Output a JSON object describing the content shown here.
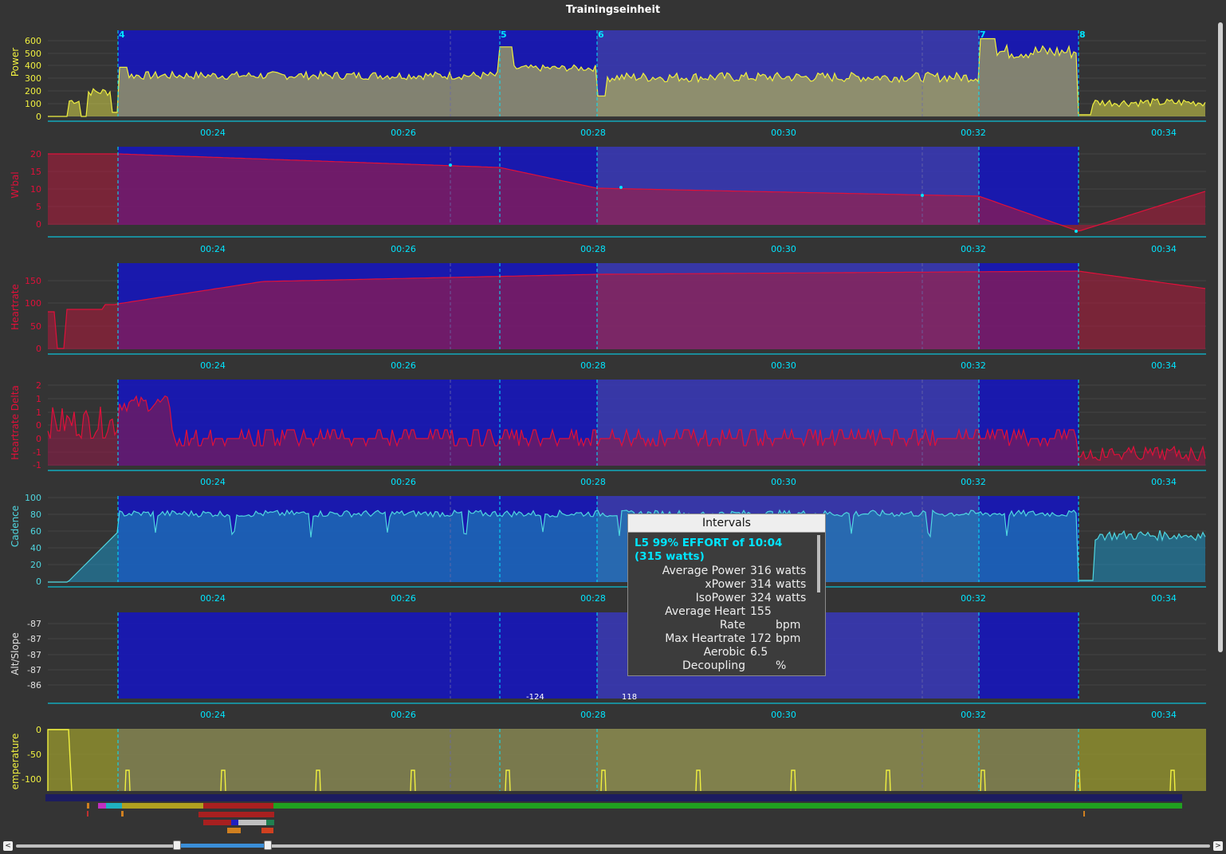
{
  "window": {
    "title": "Trainingseinheit"
  },
  "colors": {
    "background": "#343434",
    "power": "#e6e61e",
    "wbal": "#cc1133",
    "heartrate": "#cc1133",
    "cadence": "#2ab7c6",
    "axis_text": "#00e5ff",
    "interval_band": "#1414c8"
  },
  "time_ticks": [
    "00:24",
    "00:26",
    "00:28",
    "00:30",
    "00:32",
    "00:34"
  ],
  "interval_markers": [
    "4",
    "5",
    "6",
    "7",
    "8"
  ],
  "charts": [
    {
      "id": "power",
      "ylabel": "Power",
      "yticks": [
        "600",
        "500",
        "400",
        "300",
        "200",
        "100",
        "0"
      ],
      "icon": "power-line"
    },
    {
      "id": "wbal",
      "ylabel": "W'bal",
      "yticks": [
        "20",
        "15",
        "10",
        "5",
        "0"
      ],
      "icon": "wbal-line"
    },
    {
      "id": "heartrate",
      "ylabel": "Heartrate",
      "yticks": [
        "150",
        "100",
        "50",
        "0"
      ],
      "icon": "heartrate-line"
    },
    {
      "id": "hrdelta",
      "ylabel": "Heartrate Delta",
      "yticks": [
        "2",
        "1",
        "1",
        "0",
        "0",
        "-1",
        "-1"
      ],
      "icon": "hrdelta-line"
    },
    {
      "id": "cadence",
      "ylabel": "Cadence",
      "yticks": [
        "100",
        "80",
        "60",
        "40",
        "20",
        "0"
      ],
      "icon": "cadence-line"
    },
    {
      "id": "altslope",
      "ylabel": "Alt/Slope",
      "yticks": [
        "-87",
        "-87",
        "-87",
        "-87",
        "-86"
      ],
      "annotations": [
        "-124",
        "118"
      ],
      "icon": "alt-line"
    },
    {
      "id": "temperature",
      "ylabel": "emperature",
      "yticks": [
        "0",
        "-50",
        "-100"
      ],
      "icon": "temperature-line"
    }
  ],
  "tooltip": {
    "header": "Intervals",
    "title": "L5 99% EFFORT of 10:04 (315 watts)",
    "rows": [
      {
        "label": "Average Power",
        "value": "316",
        "unit": "watts"
      },
      {
        "label": "xPower",
        "value": "314",
        "unit": "watts"
      },
      {
        "label": "IsoPower",
        "value": "324",
        "unit": "watts"
      },
      {
        "label": "Average Heart",
        "value": "155",
        "unit": ""
      },
      {
        "label": "Rate",
        "value": "",
        "unit": "bpm"
      },
      {
        "label": "Max Heartrate",
        "value": "172",
        "unit": "bpm"
      },
      {
        "label": "Aerobic",
        "value": "6.5",
        "unit": ""
      },
      {
        "label": "Decoupling",
        "value": "",
        "unit": "%"
      }
    ]
  },
  "scrollbar": {
    "left_arrow": "<",
    "right_arrow": ">"
  }
}
